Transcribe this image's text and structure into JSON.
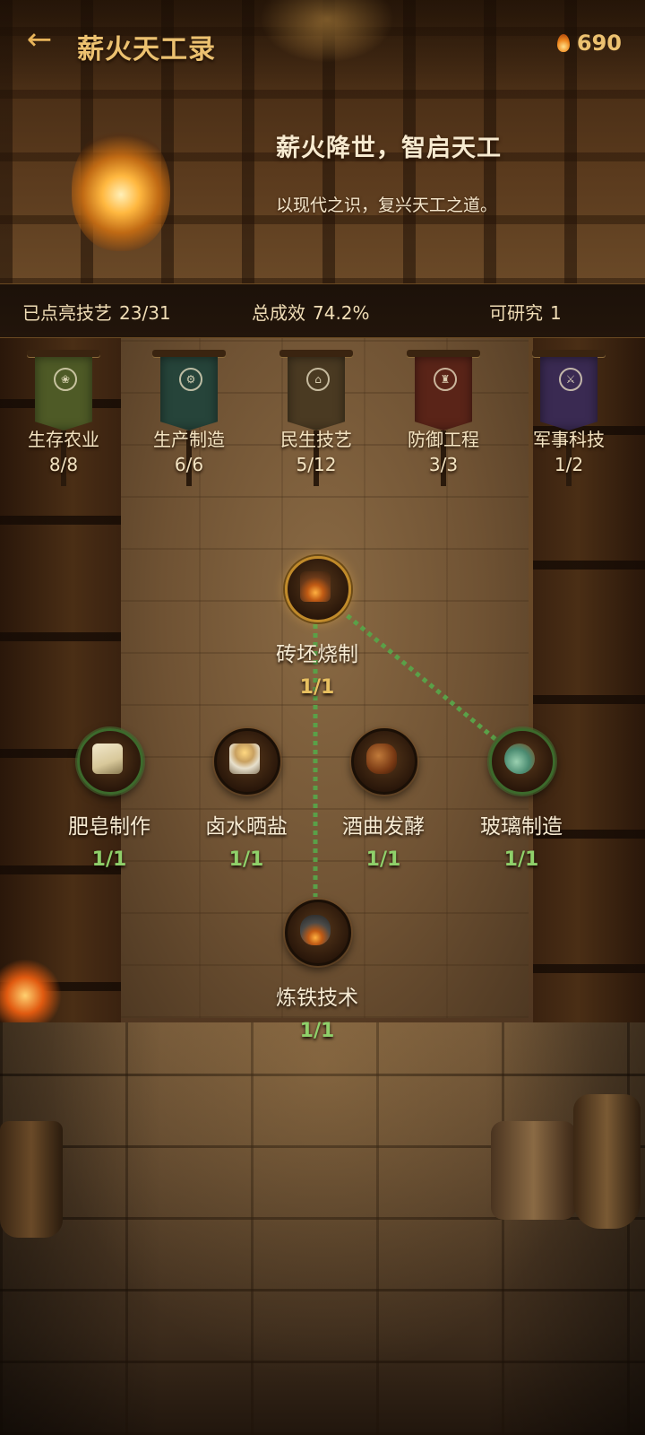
{
  "header": {
    "back_icon": "arrow-left-icon",
    "title": "薪火天工录",
    "currency_icon": "fire-icon",
    "currency_value": "690"
  },
  "banner": {
    "slogan": "薪火降世，智启天工",
    "subtitle": "以现代之识，复兴天工之道。"
  },
  "stats": {
    "unlocked_label": "已点亮技艺",
    "unlocked_value": "23/31",
    "effect_label": "总成效",
    "effect_value": "74.2%",
    "research_label": "可研究",
    "research_value": "1"
  },
  "categories": [
    {
      "name": "生存农业",
      "count": "8/8",
      "color": "#4e5a26",
      "icon": "wheat-emblem-icon"
    },
    {
      "name": "生产制造",
      "count": "6/6",
      "color": "#26443a",
      "icon": "gear-emblem-icon"
    },
    {
      "name": "民生技艺",
      "count": "5/12",
      "color": "#4a3a22",
      "icon": "house-emblem-icon"
    },
    {
      "name": "防御工程",
      "count": "3/3",
      "color": "#5a2418",
      "icon": "castle-emblem-icon"
    },
    {
      "name": "军事科技",
      "count": "1/2",
      "color": "#3a2a52",
      "icon": "crossed-swords-emblem-icon"
    }
  ],
  "nodes": [
    {
      "name": "砖坯烧制",
      "level": "1/1",
      "icon": "brick-kiln-icon",
      "state": "selected"
    },
    {
      "name": "肥皂制作",
      "level": "1/1",
      "icon": "soap-icon",
      "state": "done"
    },
    {
      "name": "卤水晒盐",
      "level": "1/1",
      "icon": "salt-icon",
      "state": "done"
    },
    {
      "name": "酒曲发酵",
      "level": "1/1",
      "icon": "wine-jar-icon",
      "state": "done"
    },
    {
      "name": "玻璃制造",
      "level": "1/1",
      "icon": "glass-flask-icon",
      "state": "done"
    },
    {
      "name": "炼铁技术",
      "level": "1/1",
      "icon": "iron-furnace-icon",
      "state": "done"
    }
  ],
  "colors": {
    "accent_gold": "#ecc170",
    "level_done": "#8fd06a",
    "level_selected": "#e8c060",
    "link_line": "#5aa048"
  }
}
